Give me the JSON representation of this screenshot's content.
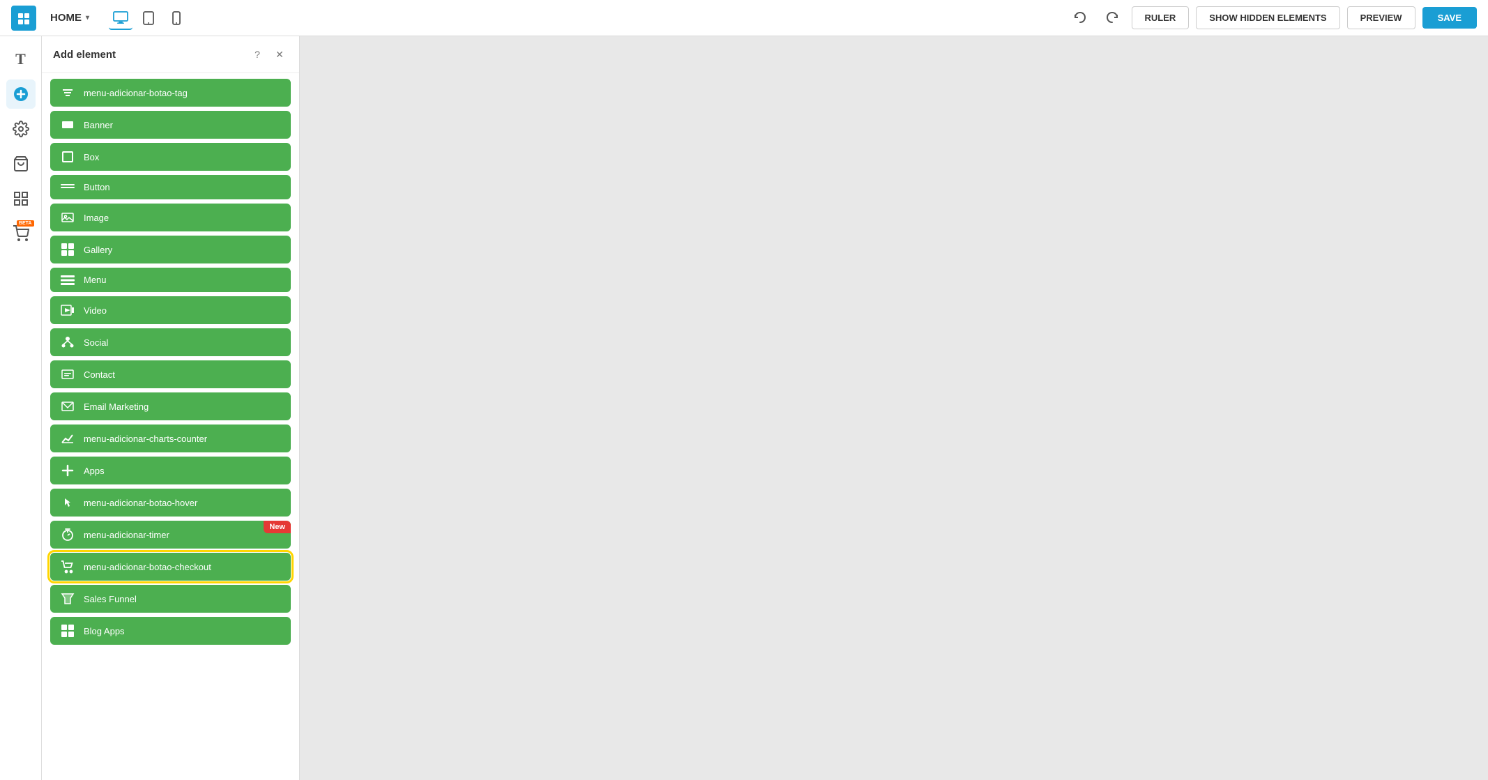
{
  "toolbar": {
    "brand_icon": "≡",
    "home_label": "HOME",
    "chevron": "▾",
    "undo_label": "Undo",
    "redo_label": "Redo",
    "ruler_label": "RULER",
    "show_hidden_label": "SHOW HIDDEN ELEMENTS",
    "preview_label": "PREVIEW",
    "save_label": "SAVE"
  },
  "panel": {
    "title": "Add element",
    "help_icon": "?",
    "close_icon": "✕"
  },
  "sidebar": {
    "items": [
      {
        "id": "text",
        "icon": "T",
        "label": "Text"
      },
      {
        "id": "add",
        "icon": "+",
        "label": "Add Element",
        "active": true
      },
      {
        "id": "settings",
        "icon": "⚙",
        "label": "Settings"
      },
      {
        "id": "store",
        "icon": "🛍",
        "label": "Store"
      },
      {
        "id": "grid",
        "icon": "▦",
        "label": "Grid"
      },
      {
        "id": "beta-apps",
        "icon": "🛒",
        "label": "Beta Apps",
        "beta": true
      }
    ]
  },
  "elements": [
    {
      "id": "menu-tag",
      "icon": "🏷",
      "label": "menu-adicionar-botao-tag",
      "new": false,
      "highlighted": false
    },
    {
      "id": "banner",
      "icon": "▬",
      "label": "Banner",
      "new": false,
      "highlighted": false
    },
    {
      "id": "box",
      "icon": "☐",
      "label": "Box",
      "new": false,
      "highlighted": false
    },
    {
      "id": "button",
      "icon": "━━━",
      "label": "Button",
      "new": false,
      "highlighted": false
    },
    {
      "id": "image",
      "icon": "🖼",
      "label": "Image",
      "new": false,
      "highlighted": false
    },
    {
      "id": "gallery",
      "icon": "⊞",
      "label": "Gallery",
      "new": false,
      "highlighted": false
    },
    {
      "id": "menu",
      "icon": "═══",
      "label": "Menu",
      "new": false,
      "highlighted": false
    },
    {
      "id": "video",
      "icon": "▶",
      "label": "Video",
      "new": false,
      "highlighted": false
    },
    {
      "id": "social",
      "icon": "❋",
      "label": "Social",
      "new": false,
      "highlighted": false
    },
    {
      "id": "contact",
      "icon": "≡□",
      "label": "Contact",
      "new": false,
      "highlighted": false
    },
    {
      "id": "email-marketing",
      "icon": "≡□",
      "label": "Email Marketing",
      "new": false,
      "highlighted": false
    },
    {
      "id": "charts-counter",
      "icon": "📈",
      "label": "menu-adicionar-charts-counter",
      "new": false,
      "highlighted": false
    },
    {
      "id": "apps",
      "icon": "+",
      "label": "Apps",
      "new": false,
      "highlighted": false
    },
    {
      "id": "hover-btn",
      "icon": "👆",
      "label": "menu-adicionar-botao-hover",
      "new": false,
      "highlighted": false
    },
    {
      "id": "timer",
      "icon": "⏱",
      "label": "menu-adicionar-timer",
      "new": true,
      "highlighted": false
    },
    {
      "id": "checkout",
      "icon": "🛒",
      "label": "menu-adicionar-botao-checkout",
      "new": false,
      "highlighted": true
    },
    {
      "id": "sales-funnel",
      "icon": "▧",
      "label": "Sales Funnel",
      "new": false,
      "highlighted": false
    },
    {
      "id": "blog-apps",
      "icon": "▦",
      "label": "Blog Apps",
      "new": false,
      "highlighted": false
    }
  ]
}
